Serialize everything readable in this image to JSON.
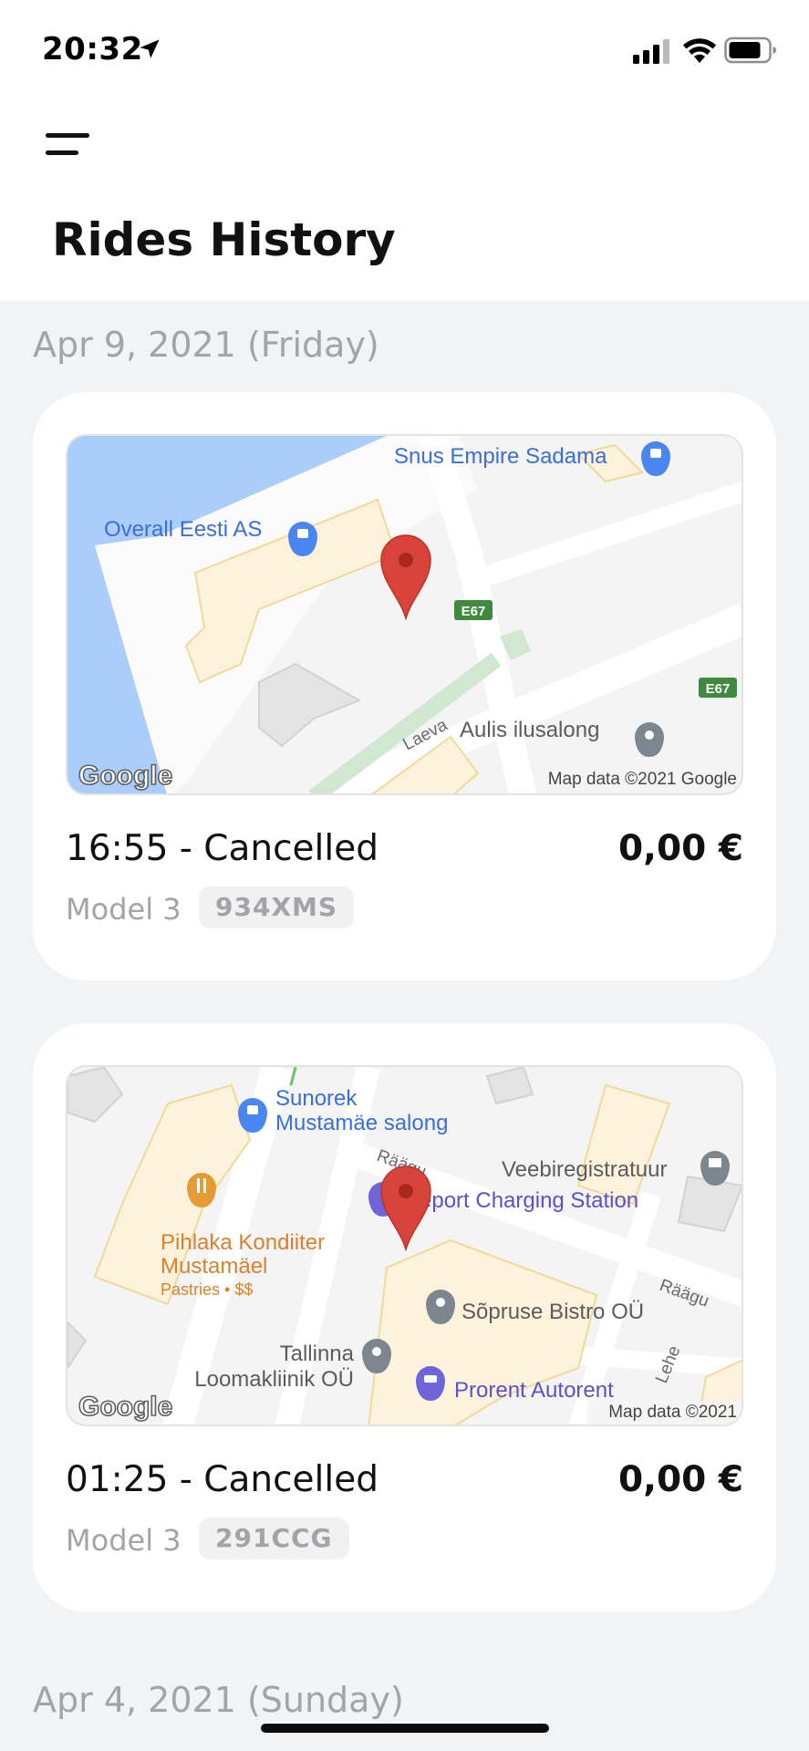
{
  "status_bar": {
    "time": "20:32"
  },
  "header": {
    "title": "Rides History"
  },
  "groups": [
    {
      "date": "Apr 9, 2021 (Friday)",
      "rides": [
        {
          "time_status": "16:55 - Cancelled",
          "price": "0,00 €",
          "model": "Model 3",
          "plate": "934XMS",
          "map": {
            "places": [
              "Snus Empire Sadama",
              "Overall Eesti AS",
              "Aulis ilusalong"
            ],
            "road_labels": [
              "E67",
              "E67",
              "Laeva"
            ],
            "brand": "Google",
            "attribution": "Map data ©2021 Google"
          }
        },
        {
          "time_status": "01:25 - Cancelled",
          "price": "0,00 €",
          "model": "Model 3",
          "plate": "291CCG",
          "map": {
            "places": [
              "Sunorek",
              "Mustamäe salong",
              "Veebiregistratuur",
              "eport Charging Station",
              "Pihlaka Kondiiter",
              "Mustamäel",
              "Pastries • $$",
              "Sõpruse Bistro OÜ",
              "Tallinna",
              "Loomakliinik OÜ",
              "Prorent Autorent"
            ],
            "road_labels": [
              "Räägu",
              "Räägu",
              "Lehe"
            ],
            "brand": "Google",
            "attribution": "Map data ©2021"
          }
        }
      ]
    },
    {
      "date": "Apr 4, 2021 (Sunday)",
      "rides": []
    }
  ],
  "colors": {
    "accent_pin": "#d9443a",
    "water": "#aacdfa",
    "map_text_blue": "#3a6fd8",
    "map_text_orange": "#d9822b",
    "muted_text": "#a2a4a8"
  }
}
